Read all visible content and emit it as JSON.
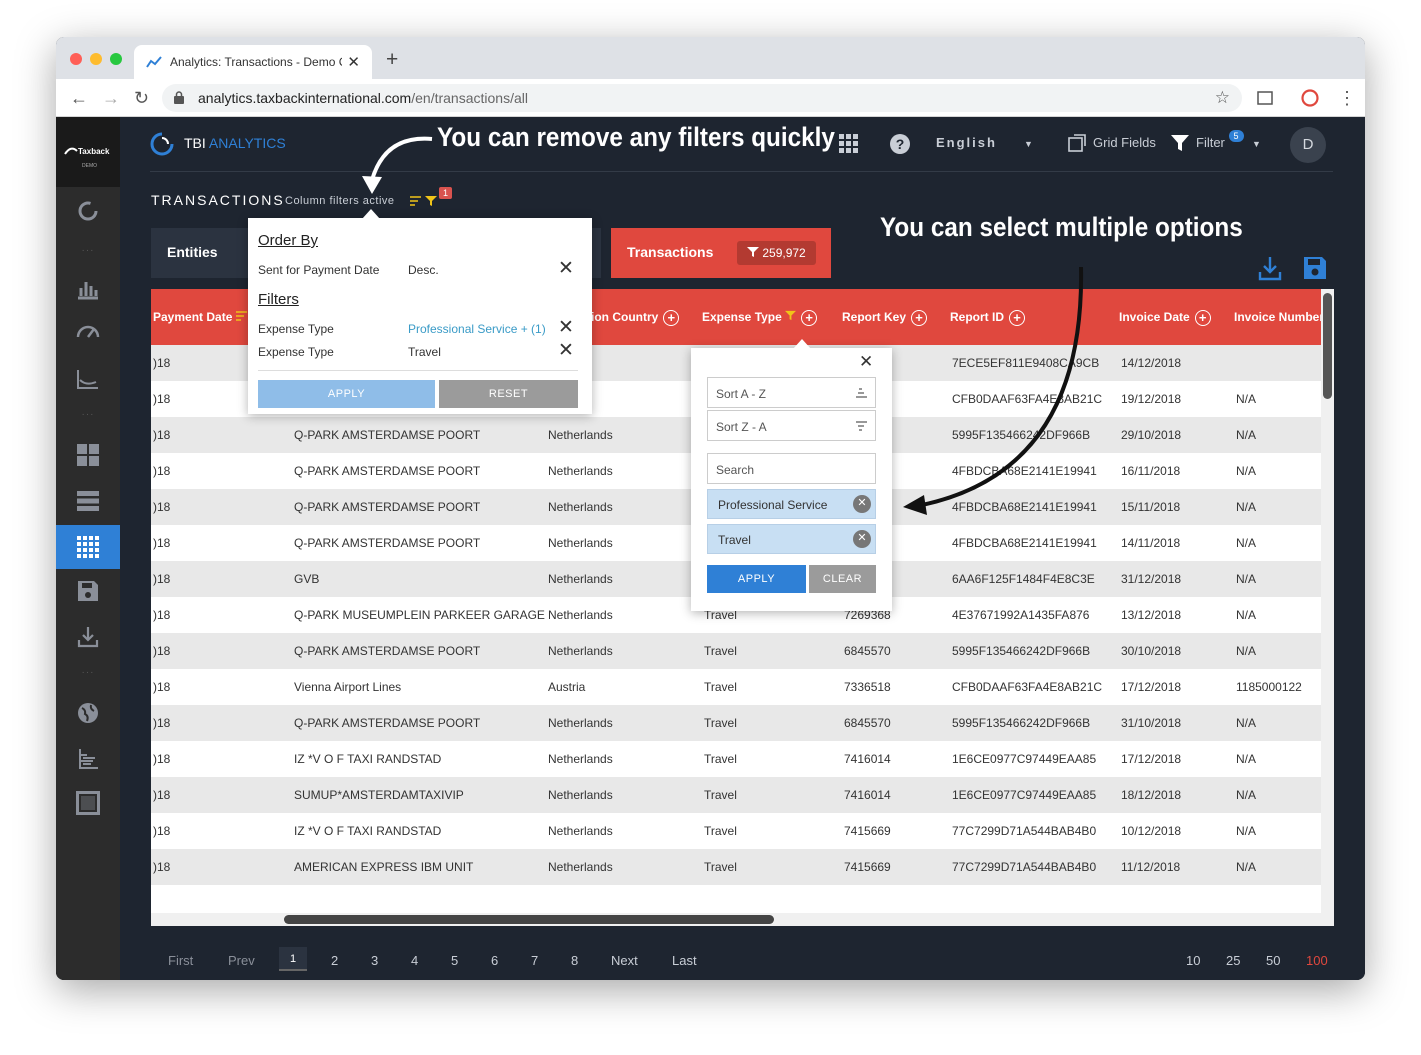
{
  "browser": {
    "tab_title": "Analytics: Transactions - Demo C",
    "url_host": "analytics.taxbackinternational.com",
    "url_path": "/en/transactions/all"
  },
  "sidebar": {
    "logo_text": "Taxback",
    "logo_sub": "DEMO",
    "items": [
      {
        "icon": "circle-icon"
      },
      {
        "icon": "bar-chart-icon"
      },
      {
        "icon": "gauge-icon"
      },
      {
        "icon": "line-chart-icon"
      },
      {
        "icon": "dashboard-icon"
      },
      {
        "icon": "list-icon"
      },
      {
        "icon": "grid-icon",
        "active": true
      },
      {
        "icon": "save-icon"
      },
      {
        "icon": "download-icon"
      },
      {
        "icon": "globe-icon"
      },
      {
        "icon": "tree-icon"
      },
      {
        "icon": "square-icon"
      }
    ]
  },
  "header": {
    "brand_main": "TBI",
    "brand_accent": "ANALYTICS",
    "language": "English",
    "grid_fields": "Grid Fields",
    "filter": "Filter",
    "filter_count": "5",
    "avatar": "D"
  },
  "page": {
    "title": "TRANSACTIONS",
    "column_filters": "Column filters active",
    "filters_badge": "1"
  },
  "kpis": {
    "entities": "Entities",
    "transactions": "Transactions",
    "transactions_count": "259,972"
  },
  "annotations": {
    "remove_filters": "You can remove any filters quickly",
    "select_multiple": "You can select multiple options"
  },
  "order_popup": {
    "order_heading": "Order By",
    "order_field": "Sent for Payment Date",
    "order_dir": "Desc.",
    "filters_heading": "Filters",
    "filter1_field": "Expense Type",
    "filter1_value": "Professional Service + (1)",
    "filter2_field": "Expense Type",
    "filter2_value": "Travel",
    "apply": "APPLY",
    "reset": "RESET"
  },
  "column_popup": {
    "sort_az": "Sort A - Z",
    "sort_za": "Sort Z - A",
    "search_placeholder": "Search",
    "chip1": "Professional Service",
    "chip2": "Travel",
    "apply": "APPLY",
    "clear": "CLEAR"
  },
  "table": {
    "headers": {
      "payment_date": "Payment Date",
      "country": "ion Country",
      "expense_type": "Expense Type",
      "report_key": "Report Key",
      "report_id": "Report ID",
      "invoice_date": "Invoice Date",
      "invoice_number": "Invoice Number"
    },
    "rows": [
      {
        "date": ")18",
        "merchant": "",
        "country": "ands",
        "type": "",
        "key": "",
        "id": "7ECE5EF811E9408CA9CB",
        "inv_date": "14/12/2018",
        "inv_no": ""
      },
      {
        "date": ")18",
        "merchant": "",
        "country": "",
        "type": "",
        "key": "",
        "id": "CFB0DAAF63FA4E8AB21C",
        "inv_date": "19/12/2018",
        "inv_no": "N/A"
      },
      {
        "date": ")18",
        "merchant": "Q-PARK AMSTERDAMSE POORT",
        "country": "Netherlands",
        "type": "",
        "key": "",
        "id": "5995F135466242DF966B",
        "inv_date": "29/10/2018",
        "inv_no": "N/A"
      },
      {
        "date": ")18",
        "merchant": "Q-PARK AMSTERDAMSE POORT",
        "country": "Netherlands",
        "type": "",
        "key": "",
        "id": "4FBDCBA68E2141E19941",
        "inv_date": "16/11/2018",
        "inv_no": "N/A"
      },
      {
        "date": ")18",
        "merchant": "Q-PARK AMSTERDAMSE POORT",
        "country": "Netherlands",
        "type": "",
        "key": "",
        "id": "4FBDCBA68E2141E19941",
        "inv_date": "15/11/2018",
        "inv_no": "N/A"
      },
      {
        "date": ")18",
        "merchant": "Q-PARK AMSTERDAMSE POORT",
        "country": "Netherlands",
        "type": "",
        "key": "",
        "id": "4FBDCBA68E2141E19941",
        "inv_date": "14/11/2018",
        "inv_no": "N/A"
      },
      {
        "date": ")18",
        "merchant": "GVB",
        "country": "Netherlands",
        "type": "",
        "key": "",
        "id": "6AA6F125F1484F4E8C3E",
        "inv_date": "31/12/2018",
        "inv_no": "N/A"
      },
      {
        "date": ")18",
        "merchant": "Q-PARK MUSEUMPLEIN PARKEER GARAGE",
        "country": "Netherlands",
        "type": "Travel",
        "key": "7269368",
        "id": "4E37671992A1435FA876",
        "inv_date": "13/12/2018",
        "inv_no": "N/A"
      },
      {
        "date": ")18",
        "merchant": "Q-PARK AMSTERDAMSE POORT",
        "country": "Netherlands",
        "type": "Travel",
        "key": "6845570",
        "id": "5995F135466242DF966B",
        "inv_date": "30/10/2018",
        "inv_no": "N/A"
      },
      {
        "date": ")18",
        "merchant": "Vienna Airport Lines",
        "country": "Austria",
        "type": "Travel",
        "key": "7336518",
        "id": "CFB0DAAF63FA4E8AB21C",
        "inv_date": "17/12/2018",
        "inv_no": "1185000122"
      },
      {
        "date": ")18",
        "merchant": "Q-PARK AMSTERDAMSE POORT",
        "country": "Netherlands",
        "type": "Travel",
        "key": "6845570",
        "id": "5995F135466242DF966B",
        "inv_date": "31/10/2018",
        "inv_no": "N/A"
      },
      {
        "date": ")18",
        "merchant": "IZ *V O F TAXI RANDSTAD",
        "country": "Netherlands",
        "type": "Travel",
        "key": "7416014",
        "id": "1E6CE0977C97449EAA85",
        "inv_date": "17/12/2018",
        "inv_no": "N/A"
      },
      {
        "date": ")18",
        "merchant": "SUMUP*AMSTERDAMTAXIVIP",
        "country": "Netherlands",
        "type": "Travel",
        "key": "7416014",
        "id": "1E6CE0977C97449EAA85",
        "inv_date": "18/12/2018",
        "inv_no": "N/A"
      },
      {
        "date": ")18",
        "merchant": "IZ *V O F TAXI RANDSTAD",
        "country": "Netherlands",
        "type": "Travel",
        "key": "7415669",
        "id": "77C7299D71A544BAB4B0",
        "inv_date": "10/12/2018",
        "inv_no": "N/A"
      },
      {
        "date": ")18",
        "merchant": "AMERICAN EXPRESS IBM UNIT",
        "country": "Netherlands",
        "type": "Travel",
        "key": "7415669",
        "id": "77C7299D71A544BAB4B0",
        "inv_date": "11/12/2018",
        "inv_no": "N/A"
      }
    ]
  },
  "pager": {
    "first": "First",
    "prev": "Prev",
    "current": "1",
    "pages": [
      "2",
      "3",
      "4",
      "5",
      "6",
      "7",
      "8"
    ],
    "next": "Next",
    "last": "Last",
    "sizes": [
      "10",
      "25",
      "50",
      "100"
    ]
  },
  "colors": {
    "accent": "#2f80d6",
    "header_red": "#e0483e",
    "app_bg": "#1e2530"
  }
}
